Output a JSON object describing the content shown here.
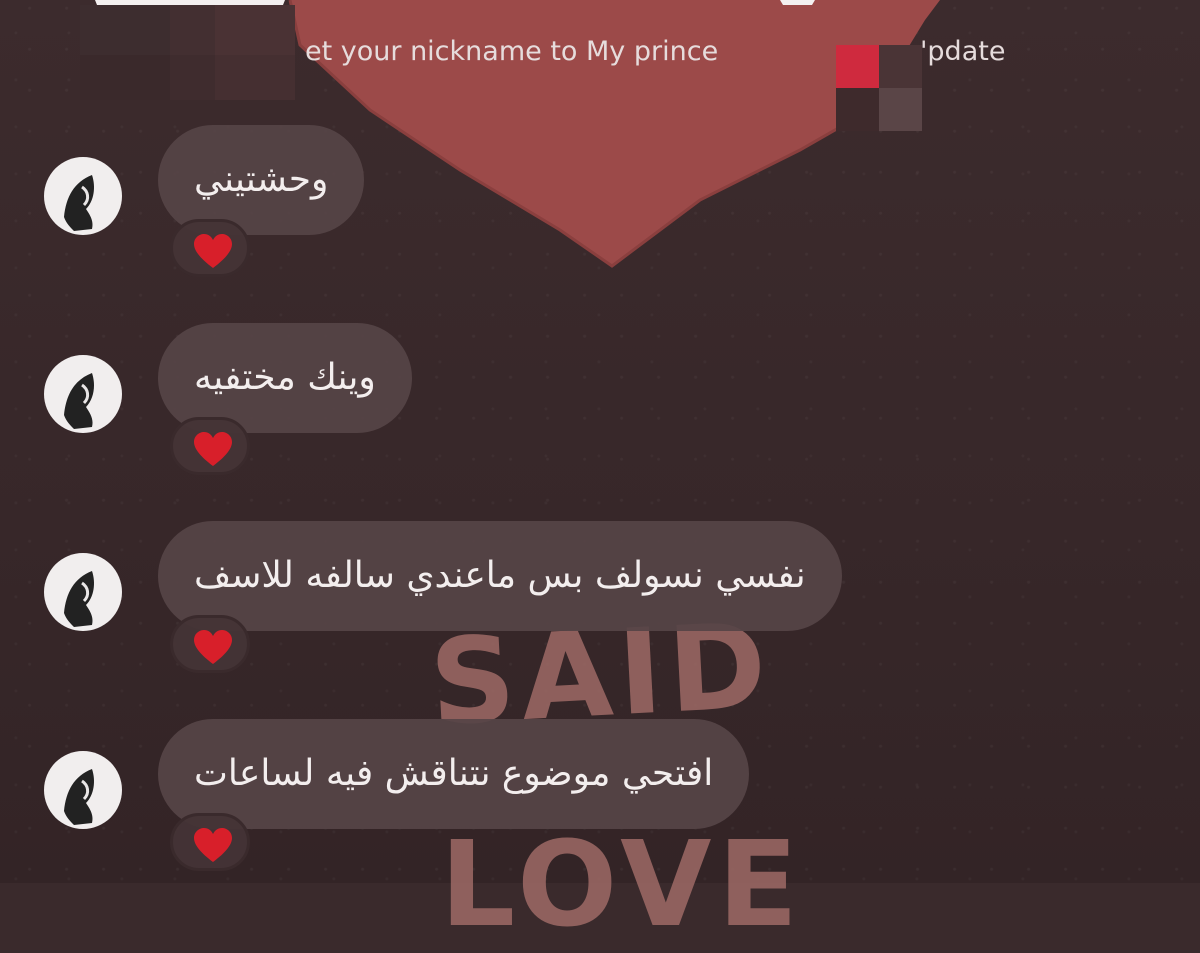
{
  "header": {
    "notification_text": "et your nickname to My prince",
    "right_text": "'pdate"
  },
  "background": {
    "art_text_top": "SAID",
    "art_text_bottom": "LOVE",
    "heart_color": "#9c4a49"
  },
  "messages": [
    {
      "text": "وحشتيني",
      "reaction": "heart-icon"
    },
    {
      "text": "وينك مختفيه",
      "reaction": "heart-icon"
    },
    {
      "text": "نفسي نسولف بس ماعندي سالفه للاسف",
      "reaction": "heart-icon"
    },
    {
      "text": "افتحي موضوع نتناقش فيه لساعات",
      "reaction": "heart-icon"
    }
  ],
  "colors": {
    "bubble": "#564446",
    "background": "#3a2a2c",
    "heart": "#d81f2a"
  }
}
